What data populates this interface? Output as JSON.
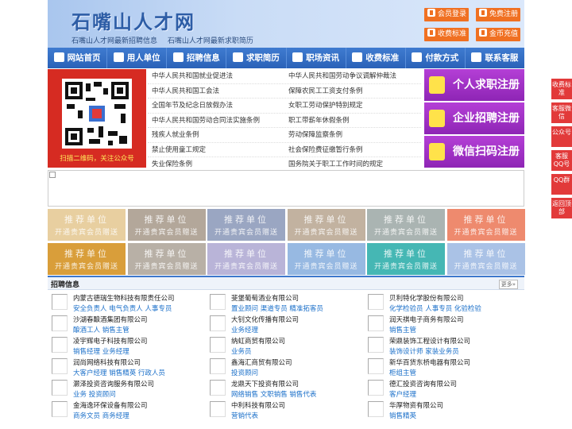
{
  "header": {
    "title": "石嘴山人才网",
    "sub_links": [
      "石嘴山人才网最新招聘信息",
      "石嘴山人才网最新求职简历"
    ],
    "buttons": [
      "会员登录",
      "免费注册",
      "收费标准",
      "金币充值"
    ]
  },
  "nav": [
    "网站首页",
    "用人单位",
    "招聘信息",
    "求职简历",
    "职场资讯",
    "收费标准",
    "付款方式",
    "联系客服"
  ],
  "qr": {
    "caption": "扫描二维码，关注公众号"
  },
  "law_links": [
    [
      "中华人民共和国就业促进法",
      "中华人民共和国劳动争议调解仲裁法"
    ],
    [
      "中华人民共和国工会法",
      "保障农民工工资支付条例"
    ],
    [
      "全国年节及纪念日放假办法",
      "女职工劳动保护特别规定"
    ],
    [
      "中华人民共和国劳动合同法实施条例",
      "职工带薪年休假条例"
    ],
    [
      "残疾人就业条例",
      "劳动保障监察条例"
    ],
    [
      "禁止使用童工规定",
      "社会保险费征缴暂行条例"
    ],
    [
      "失业保险条例",
      "国务院关于职工工作时间的规定"
    ]
  ],
  "register": [
    "个人求职注册",
    "企业招聘注册",
    "微信扫码注册"
  ],
  "tiles": {
    "line1": "推荐单位",
    "line2": "开通贵宾会员赠送",
    "row1_colors": [
      "#e8cfa0",
      "#b3a79a",
      "#9aa6c2",
      "#c2b2a0",
      "#aab4b2",
      "#ee8a6e"
    ],
    "row2_colors": [
      "#d99e3a",
      "#b8b0a6",
      "#b9b4d8",
      "#97b9e2",
      "#45b7b4",
      "#aac2e6"
    ]
  },
  "jobs_section": {
    "title": "招聘信息",
    "more": "更多»"
  },
  "jobs": [
    [
      {
        "name": "内蒙古德瑞生物科技有限责任公司",
        "positions": "安全负责人 电气负责人 人事专员"
      },
      {
        "name": "沙湖春酿酒集团有限公司",
        "positions": "酿酒工人 销售主管"
      },
      {
        "name": "凌宇辉电子科技有限公司",
        "positions": "销售经理 业务经理"
      },
      {
        "name": "润尚网络科技有限公司",
        "positions": "大客户经理 销售精英 行政人员"
      },
      {
        "name": "灏泽投资咨询服务有限公司",
        "positions": "业务 投资顾问"
      },
      {
        "name": "金海逸环保设备有限公司",
        "positions": "商务文员 商务经理"
      }
    ],
    [
      {
        "name": "斐堡葡萄酒业有限公司",
        "positions": "置业顾问 渠道专员 精准拓客员"
      },
      {
        "name": "大钊文化传播有限公司",
        "positions": "业务经理"
      },
      {
        "name": "纳虹商贸有限公司",
        "positions": "业务员"
      },
      {
        "name": "鑫海汇商贸有限公司",
        "positions": "投资顾问"
      },
      {
        "name": "龙鼎天下投资有限公司",
        "positions": "网络销售 文职销售 销售代表"
      },
      {
        "name": "中利科技有限公司",
        "positions": "营销代表"
      }
    ],
    [
      {
        "name": "贝利特化学股份有限公司",
        "positions": "化学检验员 人事专员 化验检验"
      },
      {
        "name": "润天祺电子商务有限公司",
        "positions": "销售主管"
      },
      {
        "name": "荣鼎装饰工程设计有限公司",
        "positions": "装饰设计师 家装业务员"
      },
      {
        "name": "新华百货东桥电器有限公司",
        "positions": "柜组主管"
      },
      {
        "name": "德汇投资咨询有限公司",
        "positions": "客户经理"
      },
      {
        "name": "华厚物资有限公司",
        "positions": "销售精英"
      }
    ]
  ],
  "float_bar": [
    "收费标准",
    "客服微信",
    "公众号",
    "客服QQ号",
    "QQ群",
    "返回顶部"
  ],
  "colors": {
    "nav": "#2f6cc3",
    "accent": "#f07022",
    "register": "#9b2fc2",
    "float": "#e23a3a",
    "job_link": "#1a6fc9"
  }
}
